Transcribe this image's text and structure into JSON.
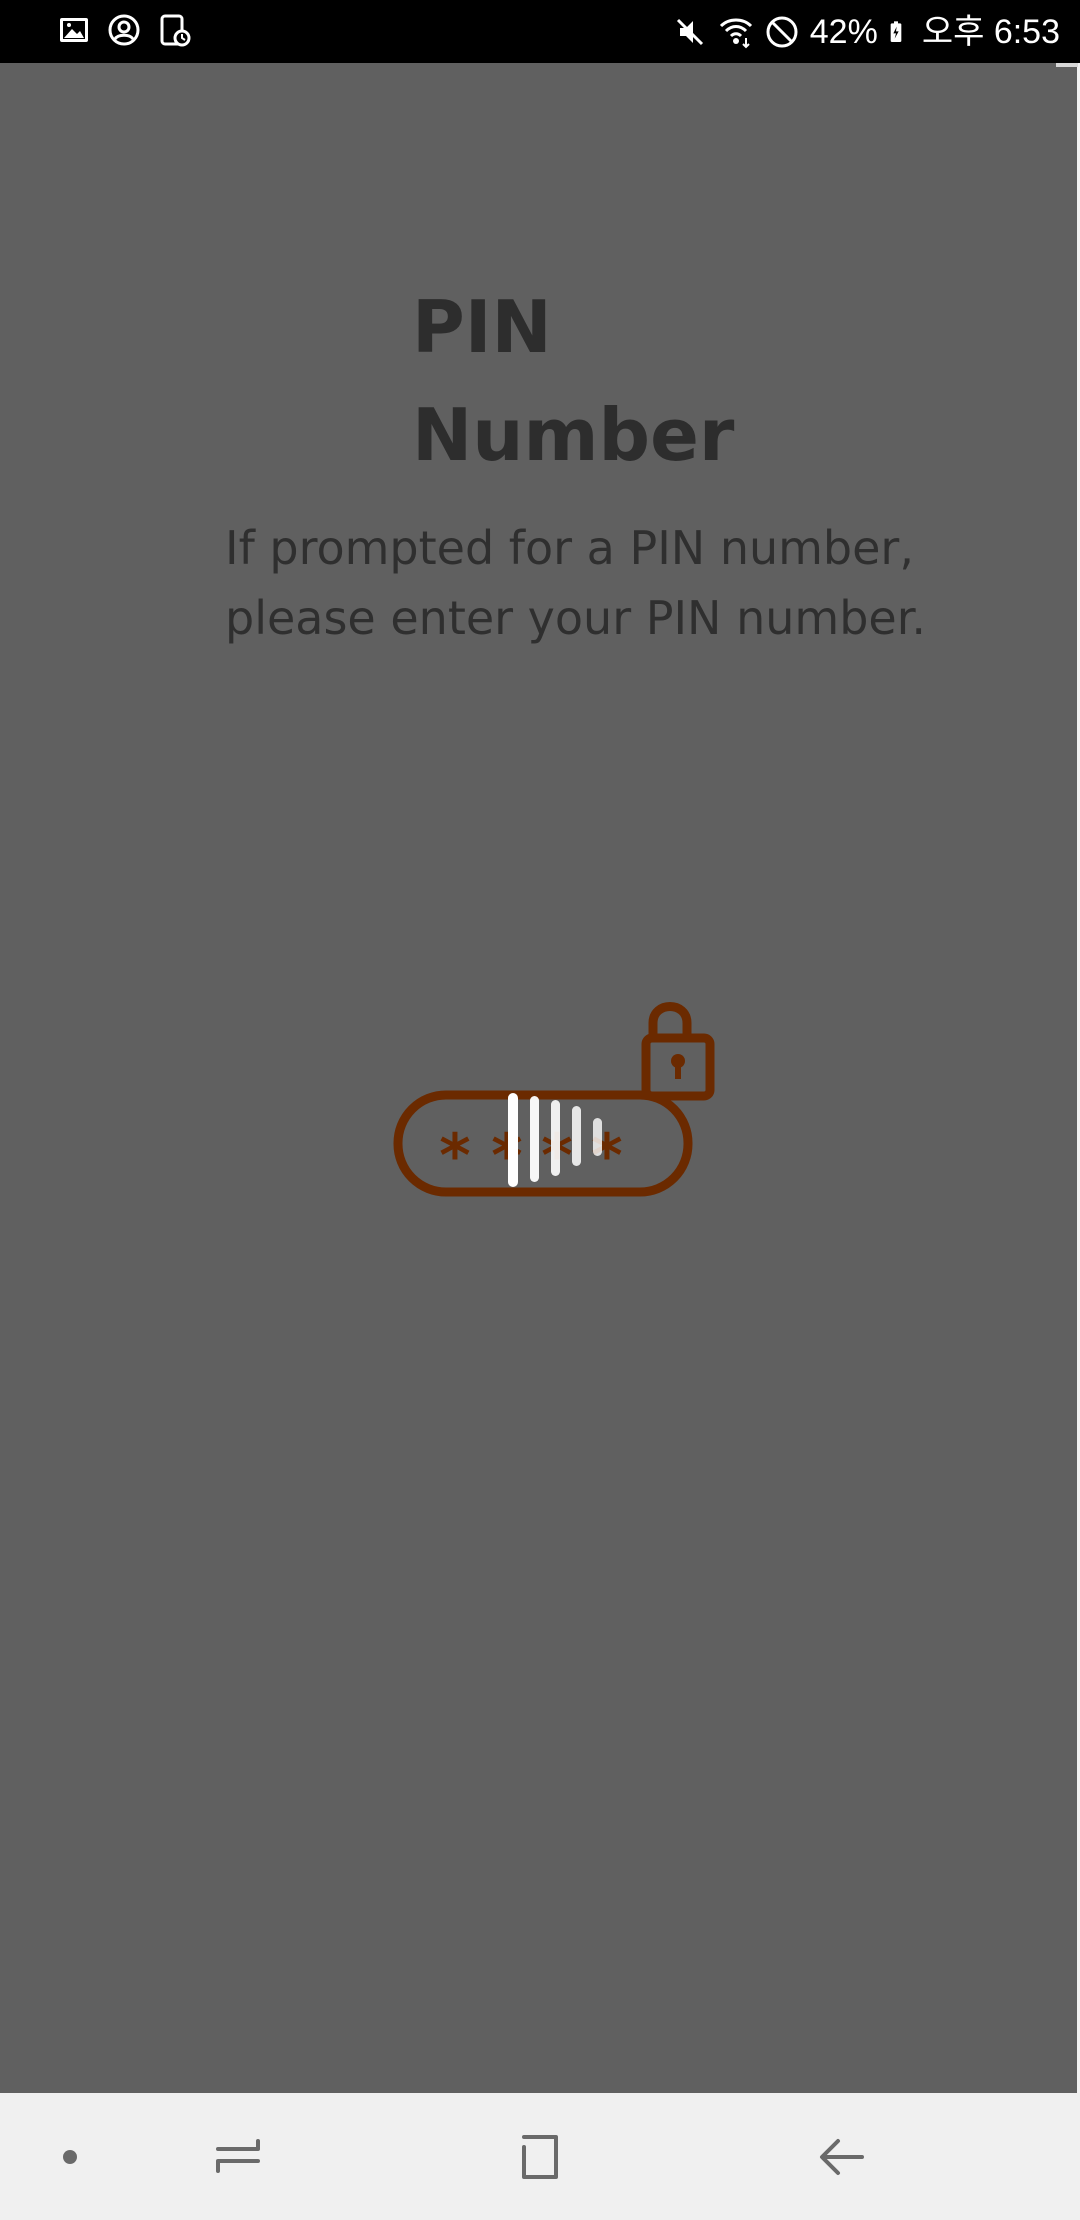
{
  "status_bar": {
    "left_icons": [
      "gallery-icon",
      "account-icon",
      "screen-time-icon"
    ],
    "right_icons": [
      "mute-icon",
      "wifi-icon",
      "do-not-disturb-icon",
      "battery-charging-icon"
    ],
    "battery_percent": "42%",
    "time": "오후 6:53"
  },
  "screen": {
    "title_lines": [
      "PIN",
      "Number"
    ],
    "description_lines": [
      "If prompted for a PIN number,",
      "please enter your PIN number."
    ],
    "illustration": {
      "name": "pin-entry-with-lock",
      "masked_chars": [
        "*",
        "*",
        "*",
        "*"
      ],
      "stroke_color": "#6b2a00"
    },
    "loading_indicator": {
      "name": "loading-bars",
      "color": "#ffffff"
    }
  },
  "nav_bar": {
    "buttons": [
      "dot-icon",
      "recents-icon",
      "home-icon",
      "back-icon"
    ]
  },
  "colors": {
    "dim_overlay": "#606060",
    "status_bar": "#000000",
    "nav_bar": "#f0f0f0",
    "accent": "#6b2a00"
  }
}
